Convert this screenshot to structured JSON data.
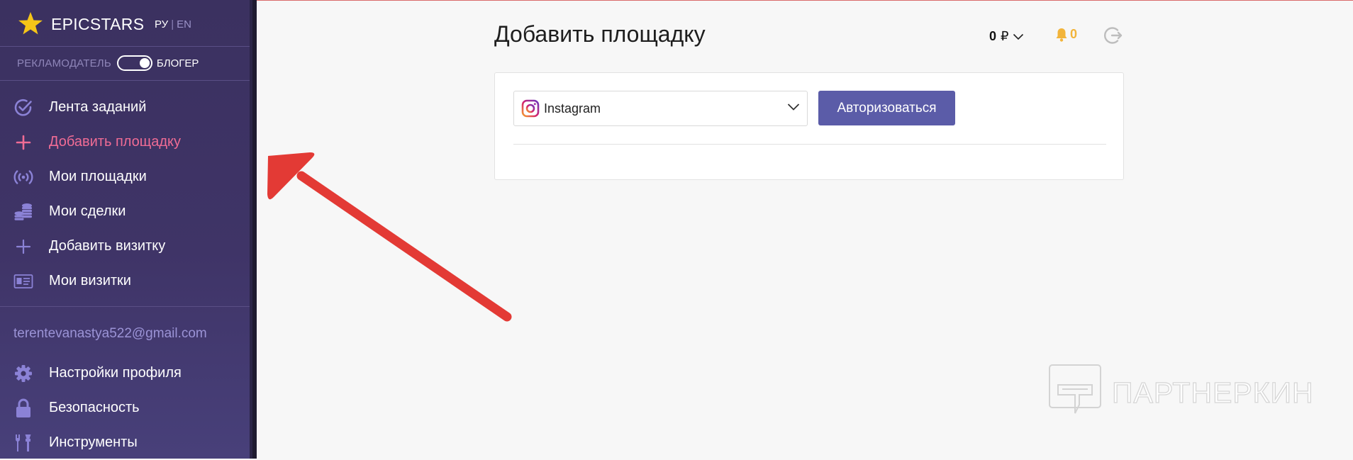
{
  "brand": {
    "name": "EPICSTARS"
  },
  "lang": {
    "active": "РУ",
    "separator": "|",
    "inactive": "EN"
  },
  "role": {
    "advertiser": "РЕКЛАМОДАТЕЛЬ",
    "blogger": "БЛОГЕР",
    "toggle_state": "blogger"
  },
  "nav": {
    "items": [
      {
        "label": "Лента заданий",
        "icon": "check-circle-icon"
      },
      {
        "label": "Добавить площадку",
        "icon": "plus-icon",
        "active": true
      },
      {
        "label": "Мои площадки",
        "icon": "broadcast-icon"
      },
      {
        "label": "Мои сделки",
        "icon": "coins-icon"
      },
      {
        "label": "Добавить визитку",
        "icon": "plus-icon"
      },
      {
        "label": "Мои визитки",
        "icon": "id-card-icon"
      }
    ]
  },
  "user": {
    "email": "terentevanastya522@gmail.com"
  },
  "nav2": {
    "items": [
      {
        "label": "Настройки профиля",
        "icon": "gear-icon"
      },
      {
        "label": "Безопасность",
        "icon": "lock-icon"
      },
      {
        "label": "Инструменты",
        "icon": "tools-icon"
      }
    ]
  },
  "header": {
    "title": "Добавить площадку",
    "balance": "0",
    "currency": "₽",
    "notifications": "0"
  },
  "form": {
    "platform_selected": "Instagram",
    "auth_button": "Авторизоваться"
  },
  "watermark": {
    "text": "ПАРТНЕРКИН"
  },
  "colors": {
    "sidebar_bg": "#3d3364",
    "active_nav": "#f06c95",
    "icon": "#8b82d6",
    "button": "#5b5ca8",
    "bell": "#f2b43a",
    "arrow": "#e53935"
  }
}
